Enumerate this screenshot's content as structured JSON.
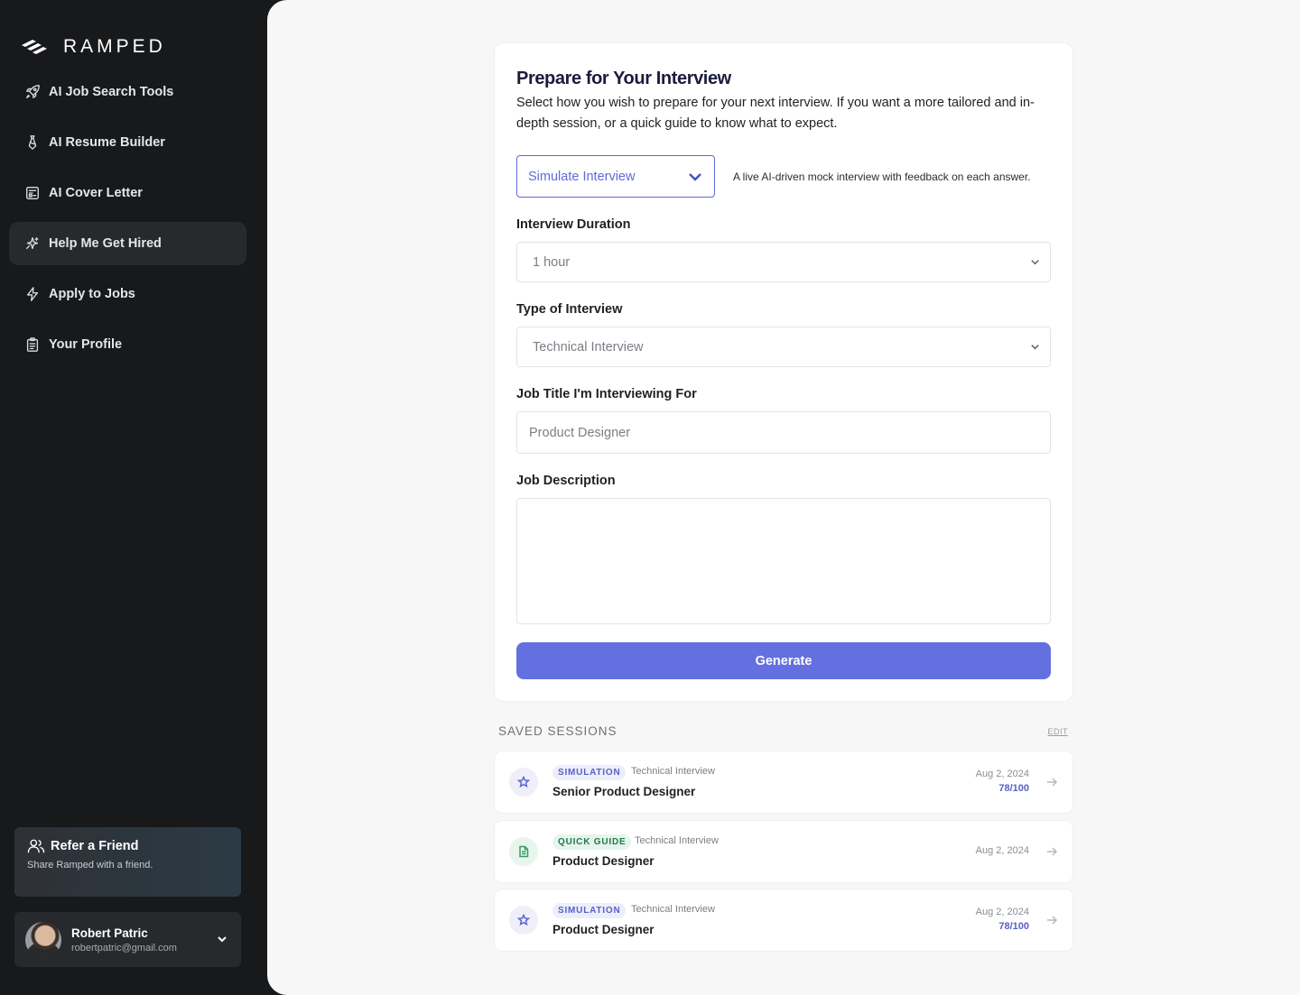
{
  "brand": {
    "name": "RAMPED"
  },
  "sidebar": {
    "items": [
      {
        "label": "AI Job Search Tools",
        "icon": "rocket-icon"
      },
      {
        "label": "AI Resume Builder",
        "icon": "tie-icon"
      },
      {
        "label": "AI Cover Letter",
        "icon": "document-icon"
      },
      {
        "label": "Help Me Get Hired",
        "icon": "sparkle-icon",
        "active": true
      },
      {
        "label": "Apply to Jobs",
        "icon": "lightning-icon"
      },
      {
        "label": "Your Profile",
        "icon": "clipboard-icon"
      }
    ],
    "refer": {
      "title": "Refer a Friend",
      "subtitle": "Share Ramped with a friend."
    },
    "user": {
      "name": "Robert Patric",
      "email": "robertpatric@gmail.com"
    }
  },
  "form": {
    "title": "Prepare for Your Interview",
    "description": "Select how you wish to prepare for your next interview. If you want a more tailored and in-depth session, or a quick guide to know what to expect.",
    "mode": {
      "value": "Simulate Interview",
      "hint": "A live AI-driven mock interview with feedback on each answer."
    },
    "duration": {
      "label": "Interview Duration",
      "value": "1 hour"
    },
    "type": {
      "label": "Type of Interview",
      "value": "Technical Interview"
    },
    "job_title": {
      "label": "Job Title I'm Interviewing For",
      "placeholder": "Product Designer"
    },
    "job_description": {
      "label": "Job Description",
      "placeholder": ""
    },
    "generate_label": "Generate"
  },
  "saved": {
    "title": "SAVED SESSIONS",
    "edit_label": "EDIT",
    "sessions": [
      {
        "badge": "SIMULATION",
        "type": "Technical Interview",
        "title": "Senior Product Designer",
        "date": "Aug 2, 2024",
        "score": "78/100"
      },
      {
        "badge": "QUICK GUIDE",
        "type": "Technical Interview",
        "title": "Product Designer",
        "date": "Aug 2, 2024",
        "score": ""
      },
      {
        "badge": "SIMULATION",
        "type": "Technical Interview",
        "title": "Product Designer",
        "date": "Aug 2, 2024",
        "score": "78/100"
      }
    ]
  },
  "colors": {
    "accent": "#6470df",
    "sidebar_bg": "#18191b",
    "main_bg": "#f7f7f8",
    "guide_green": "#1f7a4c"
  }
}
